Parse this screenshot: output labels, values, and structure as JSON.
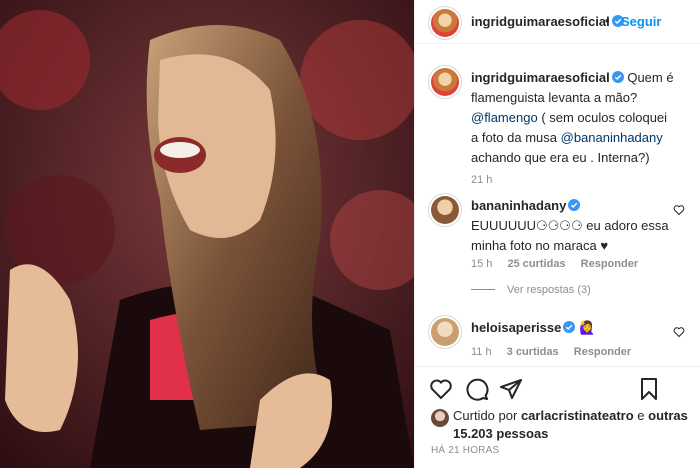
{
  "photo": {
    "description_icon": "photo"
  },
  "header": {
    "username": "ingridguimaraesoficial",
    "separator": "•",
    "follow_label": "Seguir"
  },
  "caption": {
    "username": "ingridguimaraesoficial",
    "text_1": "Quem é flamenguista levanta a mão?",
    "mention_1": "@flamengo",
    "text_2": "( sem oculos coloquei a foto da musa",
    "mention_2": "@bananinhadany",
    "text_3": "achando que era eu . Interna?)",
    "time": "21 h"
  },
  "comments": [
    {
      "username": "bananinhadany",
      "text": "EUUUUUU⚆⚆⚆⚆ eu adoro essa minha foto no maraca ♥",
      "time": "15 h",
      "likes": "25 curtidas",
      "reply": "Responder"
    },
    {
      "username": "heloisaperisse",
      "text": "🙋‍♀️",
      "time": "11 h",
      "likes": "3 curtidas",
      "reply": "Responder"
    }
  ],
  "view_replies": "Ver respostas (3)",
  "liked_by": {
    "prefix": "Curtido por",
    "user": "carlacristinateatro",
    "middle": "e",
    "others": "outras 15.203 pessoas"
  },
  "timestamp": "HÁ 21 HORAS",
  "colors": {
    "accent": "#0095f6",
    "verified": "#3897f0",
    "muted": "#8e8e8e"
  }
}
